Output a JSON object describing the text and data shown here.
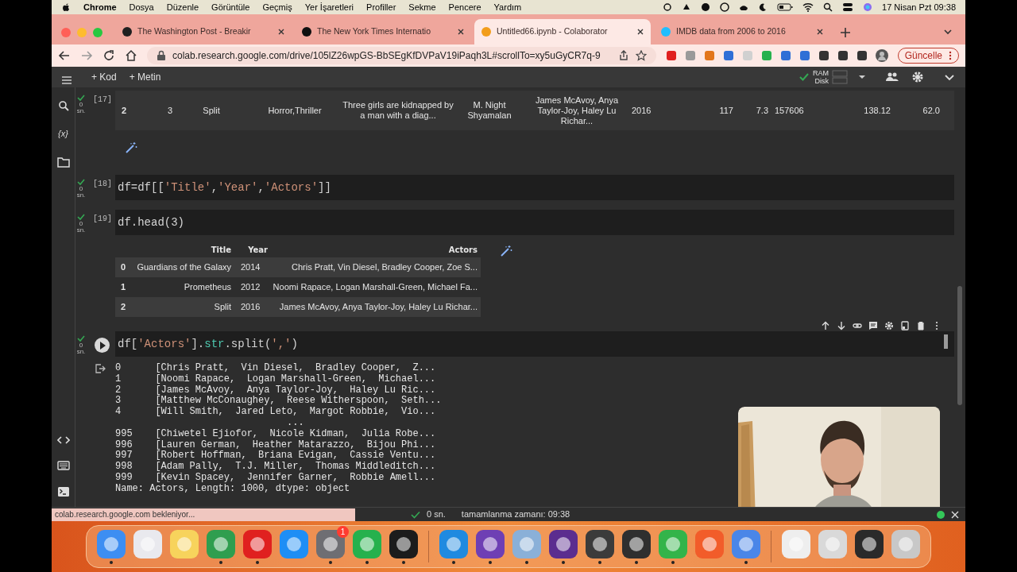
{
  "menu_bar": {
    "app": "Chrome",
    "items": [
      "Dosya",
      "Düzenle",
      "Görüntüle",
      "Geçmiş",
      "Yer İşaretleri",
      "Profiller",
      "Sekme",
      "Pencere",
      "Yardım"
    ],
    "clock": "17 Nisan Pzt 09:38"
  },
  "tabs": [
    {
      "title": "The Washington Post - Breakir",
      "selected": false,
      "color": "#202020"
    },
    {
      "title": "The New York Times Internatio",
      "selected": false,
      "color": "#101010"
    },
    {
      "title": "Untitled66.ipynb - Colaborator",
      "selected": true,
      "color": "#f29d1a"
    },
    {
      "title": "IMDB data from 2006 to 2016",
      "selected": false,
      "color": "#20beff"
    }
  ],
  "address": {
    "url": "colab.research.google.com/drive/105lZ26wpGS-BbSEgKfDVPaV19iPaqh3L#scrollTo=xy5uGyCR7q-9"
  },
  "update_button": "Güncelle",
  "colab_toolbar": {
    "add_code": "+ Kod",
    "add_text": "+ Metin",
    "ram": "RAM",
    "disk": "Disk",
    "connected": true
  },
  "sidebar": {
    "variables": "{x}"
  },
  "cells": [
    {
      "kind": "table_tail",
      "done": true,
      "exec": "[17]",
      "elapsed": "0",
      "unit": "sn.",
      "row": [
        "2",
        "3",
        "Split",
        "Horror,Thriller",
        "Three girls are kidnapped by a man with a diag...",
        "M. Night Shyamalan",
        "James McAvoy, Anya Taylor-Joy, Haley Lu Richar...",
        "2016",
        "117",
        "7.3",
        "157606",
        "138.12",
        "62.0"
      ]
    },
    {
      "kind": "code",
      "done": true,
      "exec": "[18]",
      "elapsed": "0",
      "unit": "sn.",
      "code": [
        {
          "t": "df=df[[",
          "kind": "plain"
        },
        {
          "t": "'Title'",
          "kind": "string"
        },
        {
          "t": ",",
          "kind": "plain"
        },
        {
          "t": "'Year'",
          "kind": "string"
        },
        {
          "t": ",",
          "kind": "plain"
        },
        {
          "t": "'Actors'",
          "kind": "string"
        },
        {
          "t": "]]",
          "kind": "plain"
        }
      ]
    },
    {
      "kind": "code",
      "done": true,
      "exec": "[19]",
      "elapsed": "0",
      "unit": "sn.",
      "code": [
        {
          "t": "df.head(3)",
          "kind": "plain"
        }
      ],
      "output": {
        "kind": "dataframe",
        "columns": [
          "",
          "Title",
          "Year",
          "Actors"
        ],
        "rows": [
          [
            "0",
            "Guardians of the Galaxy",
            "2014",
            "Chris Pratt, Vin Diesel, Bradley Cooper, Zoe S..."
          ],
          [
            "1",
            "Prometheus",
            "2012",
            "Noomi Rapace, Logan Marshall-Green, Michael Fa..."
          ],
          [
            "2",
            "Split",
            "2016",
            "James McAvoy, Anya Taylor-Joy, Haley Lu Richar..."
          ]
        ]
      }
    },
    {
      "kind": "code",
      "done": true,
      "focused": true,
      "elapsed": "0",
      "unit": "sn.",
      "code": [
        {
          "t": "df[",
          "kind": "plain"
        },
        {
          "t": "'Actors'",
          "kind": "string"
        },
        {
          "t": "].",
          "kind": "plain"
        },
        {
          "t": "str",
          "kind": "attr"
        },
        {
          "t": ".split(",
          "kind": "plain"
        },
        {
          "t": "','",
          "kind": "string"
        },
        {
          "t": ")",
          "kind": "plain"
        }
      ],
      "output": {
        "kind": "text",
        "text": "0      [Chris Pratt,  Vin Diesel,  Bradley Cooper,  Z...\n1      [Noomi Rapace,  Logan Marshall-Green,  Michael...\n2      [James McAvoy,  Anya Taylor-Joy,  Haley Lu Ric...\n3      [Matthew McConaughey,  Reese Witherspoon,  Seth...\n4      [Will Smith,  Jared Leto,  Margot Robbie,  Vio...\n                              ...\n995    [Chiwetel Ejiofor,  Nicole Kidman,  Julia Robe...\n996    [Lauren German,  Heather Matarazzo,  Bijou Phi...\n997    [Robert Hoffman,  Briana Evigan,  Cassie Ventu...\n998    [Adam Pally,  T.J. Miller,  Thomas Middleditch...\n999    [Kevin Spacey,  Jennifer Garner,  Robbie Amell...\nName: Actors, Length: 1000, dtype: object"
      }
    }
  ],
  "status_bar": {
    "loading": "colab.research.google.com bekleniyor...",
    "elapsed": "0 sn.",
    "completed": "tamamlanma zamanı: 09:38"
  },
  "dock": {
    "apps": [
      {
        "color": "#3d8ef2",
        "running": true
      },
      {
        "color": "#e9e9ee",
        "running": false
      },
      {
        "color": "#f7d35c",
        "running": false
      },
      {
        "color": "#2f9e4f",
        "running": true
      },
      {
        "color": "#e0201f",
        "running": true
      },
      {
        "color": "#1e8ef5",
        "running": false
      },
      {
        "color": "#6e6e73",
        "running": true,
        "badge": "1"
      },
      {
        "color": "#26b14d",
        "running": true
      },
      {
        "color": "#1c1c1c",
        "running": true
      }
    ],
    "dev": [
      {
        "color": "#1f8ae0",
        "running": true
      },
      {
        "color": "#6e3fb4",
        "running": true
      },
      {
        "color": "#8ab0d8",
        "running": true
      },
      {
        "color": "#5b2d8f",
        "running": true
      },
      {
        "color": "#3b3b3b",
        "running": true
      },
      {
        "color": "#2f2f2f",
        "running": true
      },
      {
        "color": "#33b44a",
        "running": true
      },
      {
        "color": "#f25c2a",
        "running": false
      },
      {
        "color": "#4a86e8",
        "running": true
      }
    ],
    "files": [
      {
        "color": "#eeeeee",
        "running": false
      },
      {
        "color": "#d9d9d9",
        "running": false
      },
      {
        "color": "#2a2a2a",
        "running": false
      },
      {
        "color": "#c8c8c8",
        "running": false
      }
    ]
  }
}
